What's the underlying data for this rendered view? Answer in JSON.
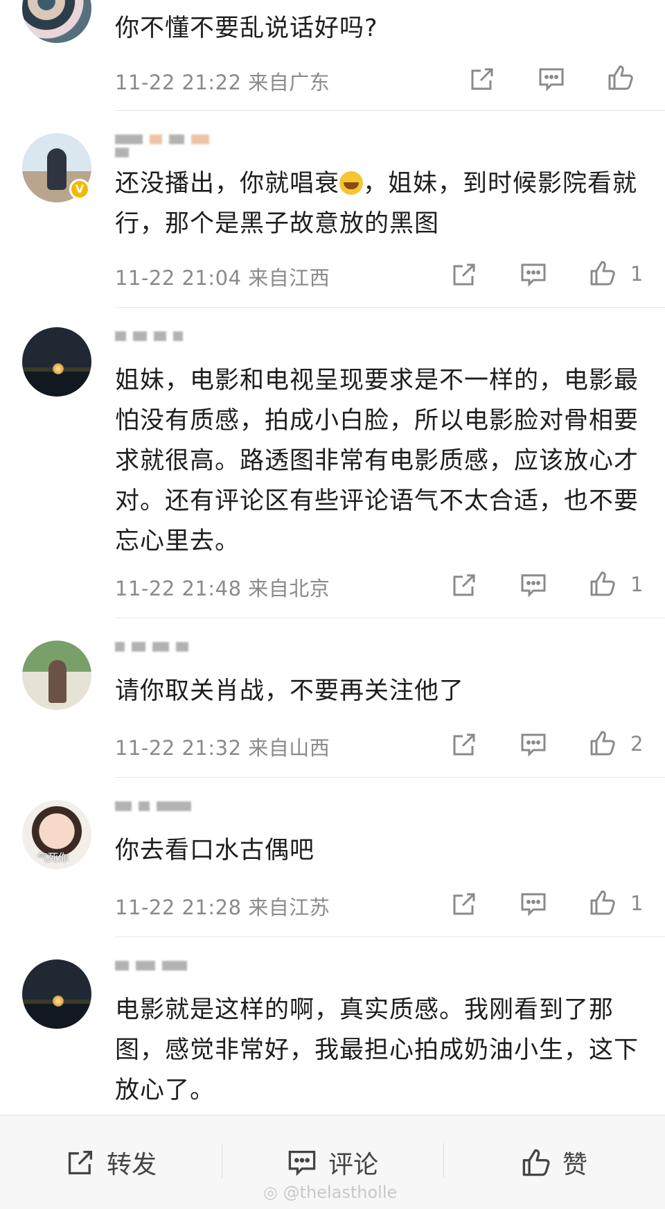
{
  "comments": [
    {
      "text": "你不懂不要乱说话好吗?",
      "time": "11-22 21:22",
      "location": "来自广东",
      "likes": ""
    },
    {
      "text": "还没播出，你就唱衰",
      "text_after_emoji": "，姐妹，到时候影院看就行，那个是黑子故意放的黑图",
      "time": "11-22 21:04",
      "location": "来自江西",
      "likes": "1",
      "verified": "V"
    },
    {
      "text": "姐妹，电影和电视呈现要求是不一样的，电影最怕没有质感，拍成小白脸，所以电影脸对骨相要求就很高。路透图非常有电影质感，应该放心才对。还有评论区有些评论语气不太合适，也不要忘心里去。",
      "time": "11-22 21:48",
      "location": "来自北京",
      "likes": "1"
    },
    {
      "text": "请你取关肖战，不要再关注他了",
      "time": "11-22 21:32",
      "location": "来自山西",
      "likes": "2"
    },
    {
      "text": "你去看口水古偶吧",
      "time": "11-22 21:28",
      "location": "来自江苏",
      "likes": "1",
      "avatar_caption": "气死你"
    },
    {
      "text": "电影就是这样的啊，真实质感。我刚看到了那图，感觉非常好，我最担心拍成奶油小生，这下放心了。"
    }
  ],
  "bottom_bar": {
    "repost": "转发",
    "comment": "评论",
    "like": "赞"
  },
  "watermark": "@thelastholle",
  "icons": {
    "share": "share-icon",
    "comment": "comment-icon",
    "like": "thumbs-up-icon"
  },
  "colors": {
    "meta": "#8a8a8a",
    "badge": "#f5b800"
  }
}
